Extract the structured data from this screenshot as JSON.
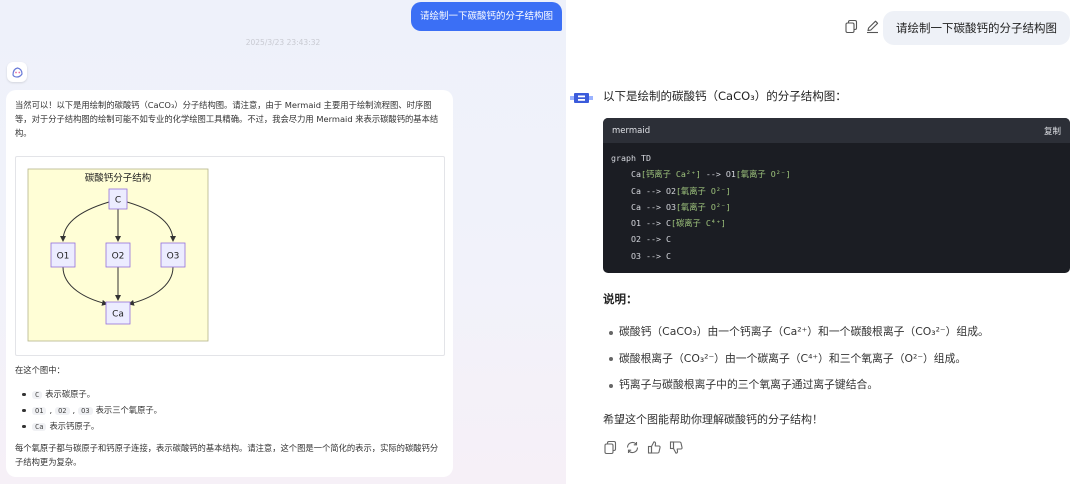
{
  "left": {
    "user_message": "请绘制一下碳酸钙的分子结构图",
    "timestamp": "2025/3/23 23:43:32",
    "intro_text": "当然可以！以下是用绘制的碳酸钙（CaCO₃）分子结构图。请注意，由于 Mermaid 主要用于绘制流程图、时序图等，对于分子结构图的绘制可能不如专业的化学绘图工具精确。不过，我会尽力用 Mermaid 来表示碳酸钙的基本结构。",
    "diagram": {
      "title": "碳酸钙分子结构",
      "nodes": {
        "c": "C",
        "o1": "O1",
        "o2": "O2",
        "o3": "O3",
        "ca": "Ca"
      }
    },
    "in_this_diagram": "在这个图中：",
    "bullets": [
      {
        "codes": [
          "C"
        ],
        "text": "表示碳原子。"
      },
      {
        "codes": [
          "O1",
          "O2",
          "O3"
        ],
        "text": "表示三个氧原子。"
      },
      {
        "codes": [
          "Ca"
        ],
        "text": "表示钙原子。"
      }
    ],
    "outro_text": "每个氧原子都与碳原子和钙原子连接，表示碳酸钙的基本结构。请注意，这个图是一个简化的表示，实际的碳酸钙分子结构更为复杂。"
  },
  "right": {
    "user_message": "请绘制一下碳酸钙的分子结构图",
    "heading": "以下是绘制的碳酸钙（CaCO₃）的分子结构图：",
    "code_lang": "mermaid",
    "copy_label": "复制",
    "code_lines": [
      {
        "plain": "graph TD",
        "str": ""
      },
      {
        "plain": "    Ca",
        "str": "[钙离子 Ca²⁺]",
        "tail": " --> O1",
        "str2": "[氧离子 O²⁻]"
      },
      {
        "plain": "    Ca --> O2",
        "str": "[氧离子 O²⁻]"
      },
      {
        "plain": "    Ca --> O3",
        "str": "[氧离子 O²⁻]"
      },
      {
        "plain": "    O1 --> C",
        "str": "[碳离子 C⁴⁺]"
      },
      {
        "plain": "    O2 --> C",
        "str": ""
      },
      {
        "plain": "    O3 --> C",
        "str": ""
      }
    ],
    "explain_title": "说明：",
    "notes": [
      "碳酸钙（CaCO₃）由一个钙离子（Ca²⁺）和一个碳酸根离子（CO₃²⁻）组成。",
      "碳酸根离子（CO₃²⁻）由一个碳离子（C⁴⁺）和三个氧离子（O²⁻）组成。",
      "钙离子与碳酸根离子中的三个氧离子通过离子键结合。"
    ],
    "closing": "希望这个图能帮助你理解碳酸钙的分子结构！",
    "icons": [
      "copy-icon",
      "edit-icon",
      "copy-response-icon",
      "regenerate-icon",
      "thumbs-up-icon",
      "thumbs-down-icon"
    ]
  }
}
